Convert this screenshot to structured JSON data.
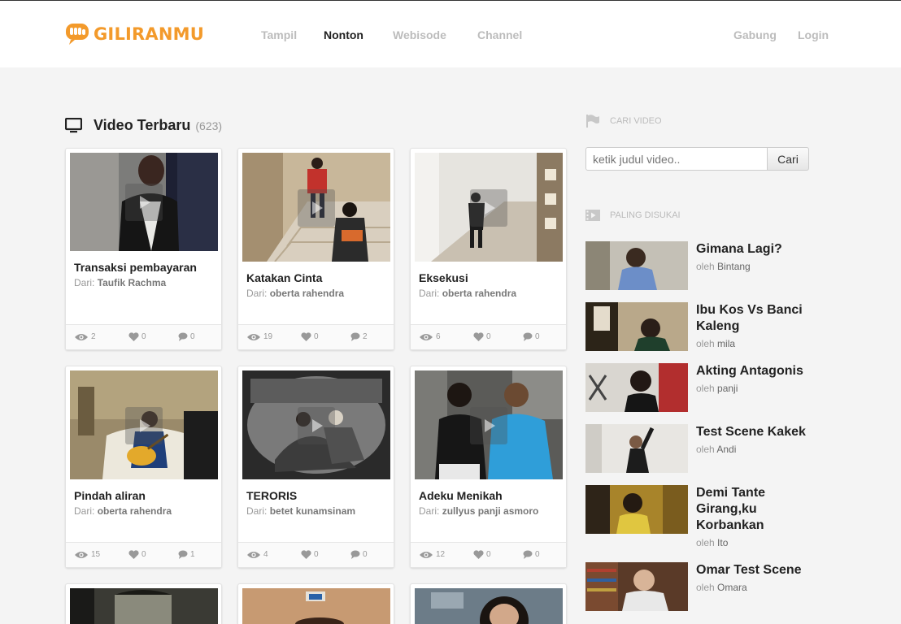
{
  "brand": {
    "name": "GILIRANMU",
    "color": "#f39a2b"
  },
  "nav": {
    "items": [
      {
        "label": "Tampil",
        "active": false
      },
      {
        "label": "Nonton",
        "active": true
      },
      {
        "label": "Webisode",
        "active": false
      },
      {
        "label": "Channel",
        "active": false
      }
    ],
    "join": "Gabung",
    "login": "Login"
  },
  "main": {
    "title": "Video Terbaru",
    "count": "(623)",
    "author_prefix": "Dari:",
    "videos": [
      {
        "title": "Transaksi pembayaran",
        "author": "Taufik Rachma",
        "views": "2",
        "likes": "0",
        "comments": "0"
      },
      {
        "title": "Katakan Cinta",
        "author": "oberta rahendra",
        "views": "19",
        "likes": "0",
        "comments": "2"
      },
      {
        "title": "Eksekusi",
        "author": "oberta rahendra",
        "views": "6",
        "likes": "0",
        "comments": "0"
      },
      {
        "title": "Pindah aliran",
        "author": "oberta rahendra",
        "views": "15",
        "likes": "0",
        "comments": "1"
      },
      {
        "title": "TERORIS",
        "author": "betet kunamsinam",
        "views": "4",
        "likes": "0",
        "comments": "0"
      },
      {
        "title": "Adeku Menikah",
        "author": "zullyus panji asmoro",
        "views": "12",
        "likes": "0",
        "comments": "0"
      }
    ]
  },
  "sidebar": {
    "search_heading": "CARI VIDEO",
    "search_placeholder": "ketik judul video..",
    "search_button": "Cari",
    "popular_heading": "PALING DISUKAI",
    "by_prefix": "oleh",
    "popular": [
      {
        "title": "Gimana Lagi?",
        "author": "Bintang"
      },
      {
        "title": "Ibu Kos Vs Banci Kaleng",
        "author": "mila"
      },
      {
        "title": "Akting Antagonis",
        "author": "panji"
      },
      {
        "title": "Test Scene Kakek",
        "author": "Andi"
      },
      {
        "title": "Demi Tante Girang,ku Korbankan",
        "author": "Ito"
      },
      {
        "title": "Omar Test Scene",
        "author": "Omara"
      }
    ]
  }
}
